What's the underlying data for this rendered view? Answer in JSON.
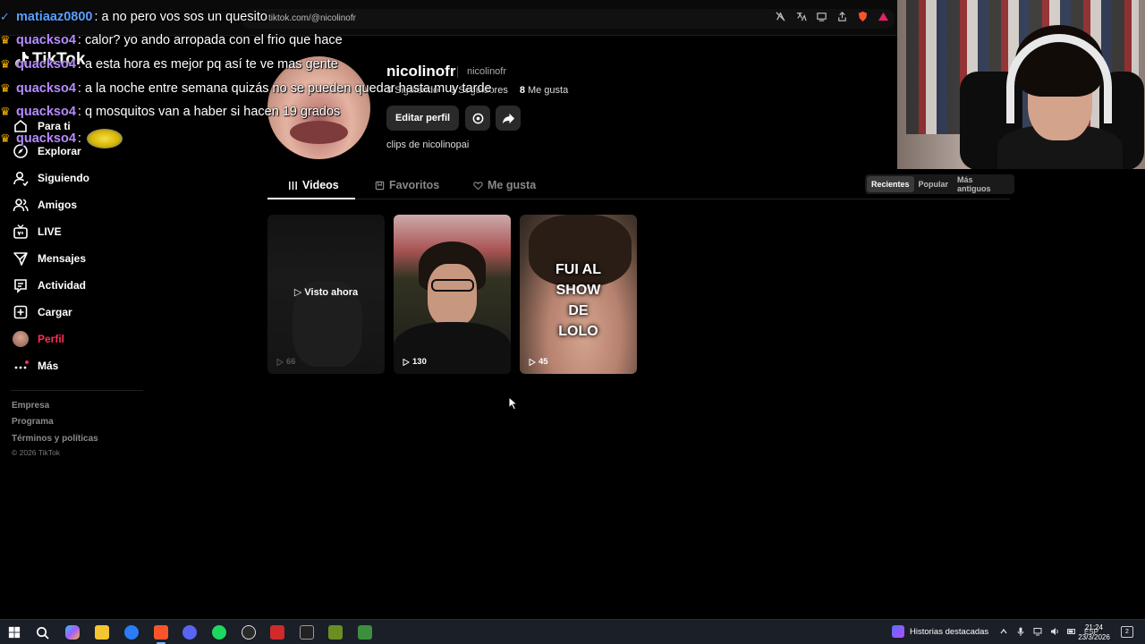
{
  "browser": {
    "url": "tiktok.com/@nicolinofr",
    "icons": [
      "no-translate-icon",
      "translate-icon",
      "cast-icon",
      "share-icon",
      "brave-shield-icon",
      "brave-rewards-icon"
    ]
  },
  "app": {
    "logo_text": "TikTok"
  },
  "sidebar": {
    "items": [
      {
        "label": "Para ti",
        "icon": "home-icon"
      },
      {
        "label": "Explorar",
        "icon": "compass-icon"
      },
      {
        "label": "Siguiendo",
        "icon": "following-icon"
      },
      {
        "label": "Amigos",
        "icon": "friends-icon"
      },
      {
        "label": "LIVE",
        "icon": "live-icon"
      },
      {
        "label": "Mensajes",
        "icon": "messages-icon"
      },
      {
        "label": "Actividad",
        "icon": "activity-icon"
      },
      {
        "label": "Cargar",
        "icon": "upload-icon"
      },
      {
        "label": "Perfil",
        "icon": "avatar",
        "active": true
      },
      {
        "label": "Más",
        "icon": "more-icon"
      }
    ],
    "footer_links": [
      "Empresa",
      "Programa",
      "Términos y políticas"
    ],
    "copyright": "© 2026 TikTok"
  },
  "profile": {
    "username": "nicolinofr",
    "nickname": "nicolinofr",
    "stats": [
      {
        "value": "3",
        "label": "Siguiendo"
      },
      {
        "value": "3",
        "label": "Seguidores"
      },
      {
        "value": "8",
        "label": "Me gusta"
      }
    ],
    "edit_label": "Editar perfil",
    "bio": "clips de nicolinopai"
  },
  "tabs": [
    {
      "label": "Videos",
      "active": true
    },
    {
      "label": "Favoritos"
    },
    {
      "label": "Me gusta"
    }
  ],
  "sort": {
    "options": [
      "Recientes",
      "Popular",
      "Más antiguos"
    ],
    "selected": "Recientes"
  },
  "videos": [
    {
      "watched_label": "Visto ahora",
      "views": "66"
    },
    {
      "views": "130"
    },
    {
      "overlay_text": "FUI AL\nSHOW\nDE\nLOLO",
      "views": "45"
    }
  ],
  "chat": [
    {
      "user": "matiaaz0800",
      "message": ": a no pero vos sos un quesito",
      "user_color": "#5aa0ff",
      "badges": [
        "verified-icon"
      ]
    },
    {
      "user": "quackso4",
      "message": ": calor? yo ando arropada con el frio que hace",
      "user_color": "#b58cff"
    },
    {
      "user": "quackso4",
      "message": ": a esta hora es mejor pq así te ve mas gente",
      "user_color": "#b58cff"
    },
    {
      "user": "quackso4",
      "message": ": a la noche entre semana quizás no se pueden quedar hasta muy tarde",
      "user_color": "#b58cff"
    },
    {
      "user": "quackso4",
      "message": ": q mosquitos van a haber si hacen 19 grados",
      "user_color": "#b58cff"
    },
    {
      "user": "quackso4",
      "message": ":",
      "user_color": "#b58cff",
      "emote": "minion-emote"
    }
  ],
  "taskbar": {
    "apps": [
      "windows-start-icon",
      "search-icon",
      "copilot-icon",
      "file-explorer-icon",
      "chrome-icon",
      "brave-icon",
      "discord-icon",
      "spotify-icon",
      "obs-icon",
      "video-editor-icon",
      "epic-games-icon",
      "app-icon",
      "minecraft-icon"
    ],
    "news_label": "Historias destacadas",
    "language": "ESP",
    "time": "21:24",
    "date": "23/3/2026",
    "notifications": "2"
  }
}
